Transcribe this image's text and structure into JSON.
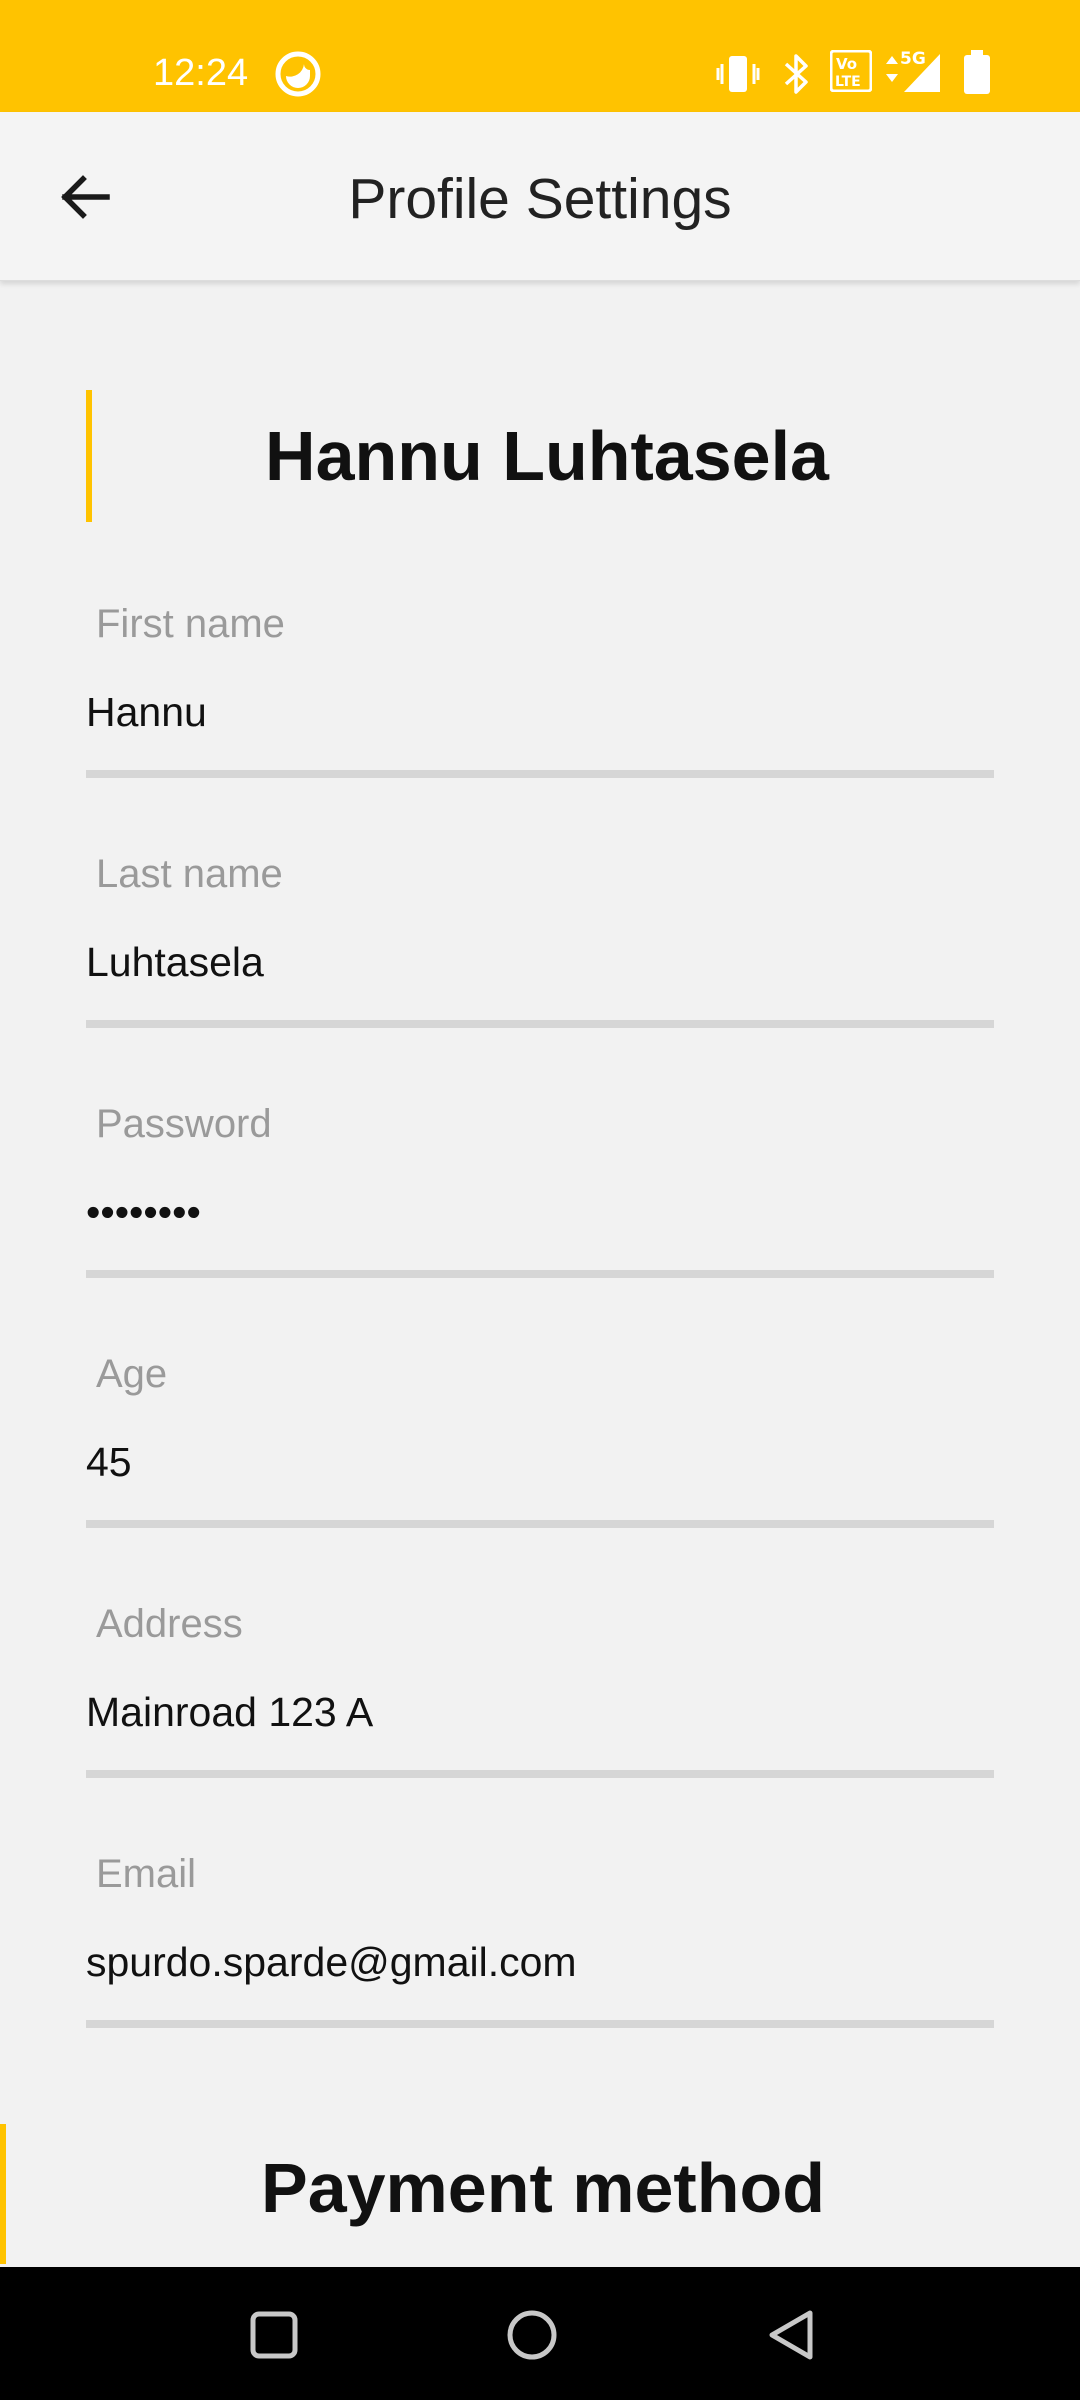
{
  "status_bar": {
    "time": "12:24",
    "background_color": "#ffc300",
    "icons": [
      "ring-icon",
      "vibrate-icon",
      "bluetooth-icon",
      "volte-icon",
      "signal-5g-icon",
      "battery-icon"
    ],
    "network_label": "5G",
    "volte_label_top": "Vo",
    "volte_label_bottom": "LTE"
  },
  "app_bar": {
    "title": "Profile Settings",
    "back_icon": "arrow-left-icon"
  },
  "profile": {
    "display_name": "Hannu Luhtasela",
    "accent_color": "#ffc300"
  },
  "fields": {
    "first_name": {
      "label": "First name",
      "value": "Hannu"
    },
    "last_name": {
      "label": "Last name",
      "value": "Luhtasela"
    },
    "password": {
      "label": "Password",
      "value": "••••••••"
    },
    "age": {
      "label": "Age",
      "value": "45"
    },
    "address": {
      "label": "Address",
      "value": "Mainroad 123 A"
    },
    "email": {
      "label": "Email",
      "value": "spurdo.sparde@gmail.com"
    }
  },
  "payment": {
    "title": "Payment method"
  },
  "nav_bar": {
    "icons": [
      "square-recents-icon",
      "circle-home-icon",
      "triangle-back-icon"
    ]
  }
}
